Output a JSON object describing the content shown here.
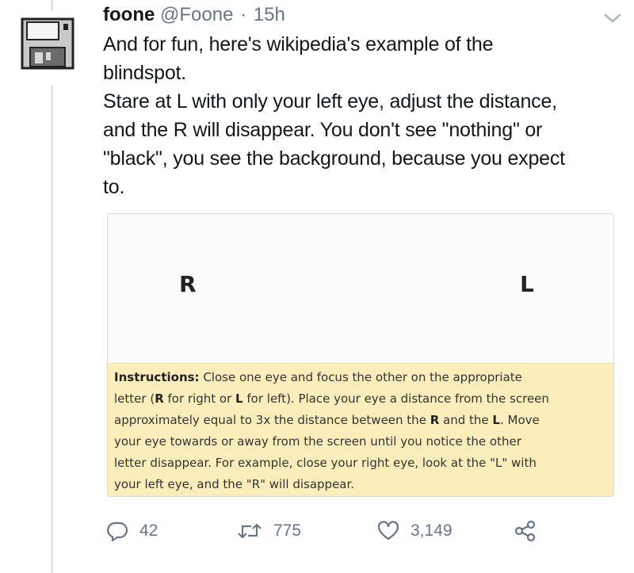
{
  "tweet": {
    "display_name": "foone",
    "handle": "@Foone",
    "separator": "·",
    "time": "15h",
    "lines": [
      "And for fun, here's wikipedia's example of the",
      "blindspot.",
      "Stare at L with only your left eye, adjust the distance,",
      "and the R will disappear. You don't see \"nothing\" or",
      "\"black\", you see the background, because you expect",
      "to."
    ]
  },
  "card": {
    "letter_left": "R",
    "letter_right": "L",
    "instructions": {
      "line1": {
        "bold": "Instructions:",
        "rest": " Close one eye and focus the other on the appropriate"
      },
      "line2": {
        "a": "letter (",
        "b1": "R",
        "c": " for right or ",
        "b2": "L",
        "d": " for left). Place your eye a distance from the screen"
      },
      "line3": {
        "a": "approximately equal to 3x the distance between the ",
        "b1": "R",
        "c": " and the ",
        "b2": "L",
        "d": ". Move"
      },
      "line4": "your eye towards or away from the screen until you notice the other",
      "line5": "letter disappear. For example, close your right eye, look at the \"L\" with",
      "line6": "your left eye, and the \"R\" will disappear."
    }
  },
  "actions": {
    "reply_count": "42",
    "retweet_count": "775",
    "like_count": "3,149"
  },
  "icons": {
    "reply": "reply-icon",
    "retweet": "retweet-icon",
    "like": "heart-icon",
    "share": "share-icon",
    "menu": "chevron-down-icon",
    "avatar": "floppy-disk-avatar"
  },
  "colors": {
    "secondary_text": "#657786",
    "instructions_bg": "#fbeeba"
  }
}
